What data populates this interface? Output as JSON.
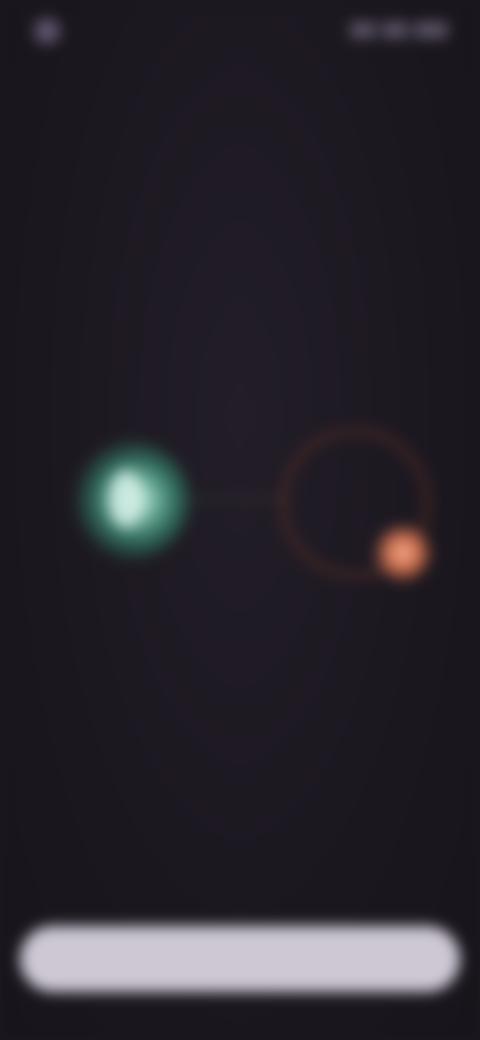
{
  "status_bar": {
    "time": ""
  },
  "header": {
    "title": ""
  },
  "headline": "",
  "graphic": {
    "caption": "",
    "left_icon": "teal-glow-icon",
    "right_icon": "orange-ring-icon",
    "colors": {
      "teal": "#7fbfaa",
      "orange": "#d16f4d"
    }
  },
  "footer": {
    "note": "",
    "primary_button_label": ""
  },
  "colors": {
    "background": "#1c1820",
    "button": "#cdc8d4"
  }
}
